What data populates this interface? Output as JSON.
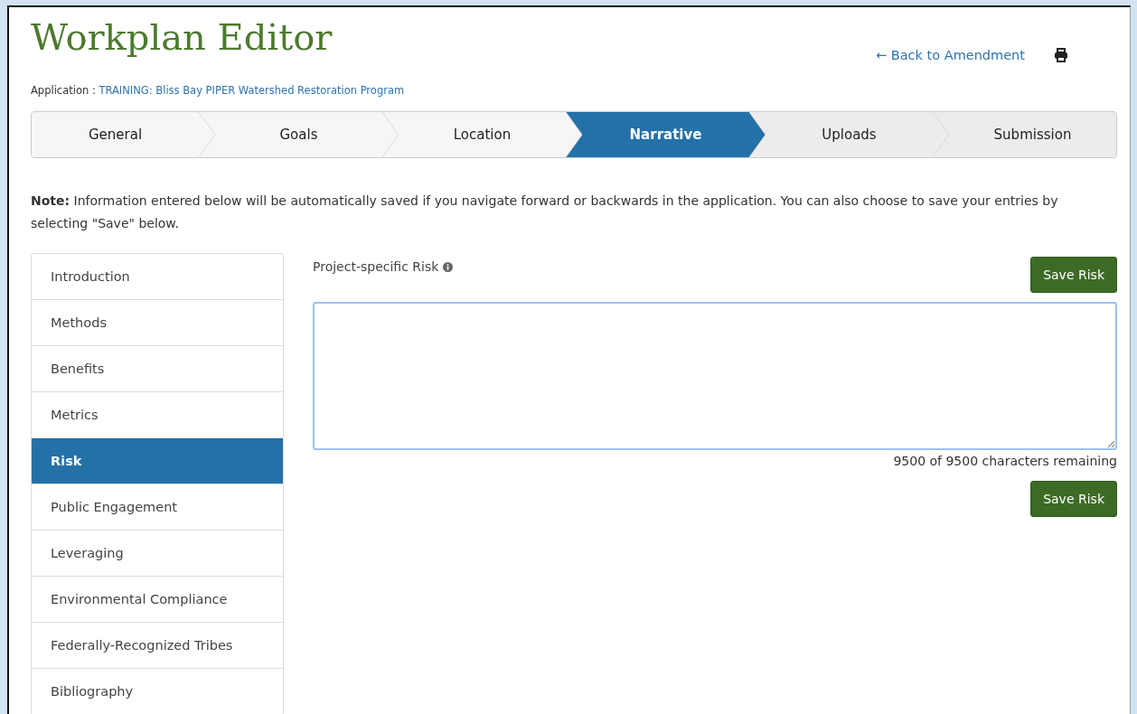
{
  "header": {
    "title": "Workplan Editor",
    "back_link": "← Back to Amendment",
    "application_label": "Application :",
    "application_name": "TRAINING: Bliss Bay PIPER Watershed Restoration Program"
  },
  "steps": [
    {
      "label": "General",
      "selected": false
    },
    {
      "label": "Goals",
      "selected": false
    },
    {
      "label": "Location",
      "selected": false
    },
    {
      "label": "Narrative",
      "selected": true
    },
    {
      "label": "Uploads",
      "selected": false
    },
    {
      "label": "Submission",
      "selected": false
    }
  ],
  "note": "**Note:** Information entered below will be automatically saved if you navigate forward or backwards in the application. You can also choose to save your entries by selecting \"Save\" below.",
  "sidebar": {
    "items": [
      {
        "label": "Introduction",
        "selected": false
      },
      {
        "label": "Methods",
        "selected": false
      },
      {
        "label": "Benefits",
        "selected": false
      },
      {
        "label": "Metrics",
        "selected": false
      },
      {
        "label": "Risk",
        "selected": true
      },
      {
        "label": "Public Engagement",
        "selected": false
      },
      {
        "label": "Leveraging",
        "selected": false
      },
      {
        "label": "Environmental Compliance",
        "selected": false
      },
      {
        "label": "Federally-Recognized Tribes",
        "selected": false
      },
      {
        "label": "Bibliography",
        "selected": false
      }
    ]
  },
  "form": {
    "label": "Project-specific Risk",
    "save_button_top": "Save Risk",
    "counter": "9500 of 9500 characters remaining",
    "save_button_bottom": "Save Risk"
  }
}
